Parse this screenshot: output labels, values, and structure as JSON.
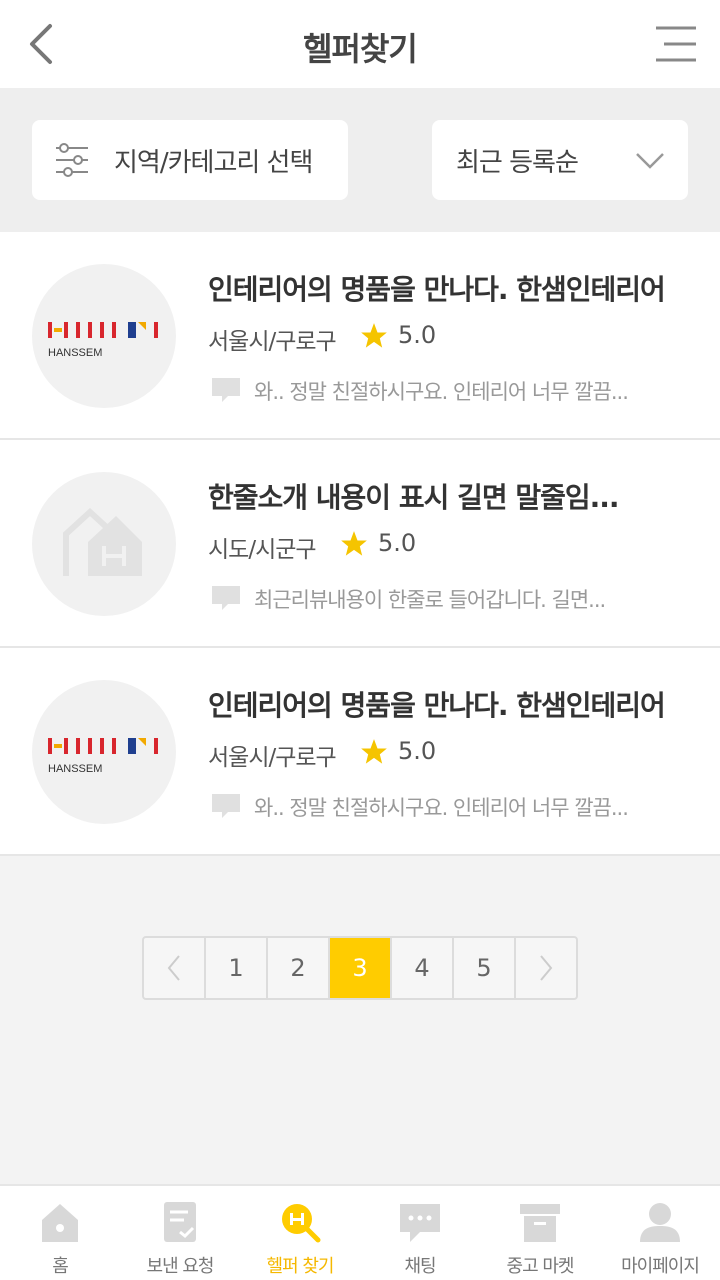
{
  "header": {
    "title": "헬퍼찾기"
  },
  "filters": {
    "region_label": "지역/카테고리 선택",
    "sort_label": "최근 등록순"
  },
  "helpers": [
    {
      "name": "인테리어의 명품을 만나다. 한샘인테리어",
      "region": "서울시/구로구",
      "rating": "5.0",
      "review": "와.. 정말 친절하시구요. 인테리어 너무 깔끔...",
      "logo": "hanssem",
      "logo_text": "HANSSEM"
    },
    {
      "name": "한줄소개 내용이 표시 길면 말줄임...",
      "region": "시도/시군구",
      "rating": "5.0",
      "review": "최근리뷰내용이 한줄로 들어갑니다. 길면...",
      "logo": "placeholder-house"
    },
    {
      "name": "인테리어의 명품을 만나다. 한샘인테리어",
      "region": "서울시/구로구",
      "rating": "5.0",
      "review": "와.. 정말 친절하시구요. 인테리어 너무 깔끔...",
      "logo": "hanssem",
      "logo_text": "HANSSEM"
    }
  ],
  "pagination": {
    "pages": [
      "1",
      "2",
      "3",
      "4",
      "5"
    ],
    "current": "3"
  },
  "tabs": [
    {
      "label": "홈",
      "icon": "home-icon"
    },
    {
      "label": "보낸 요청",
      "icon": "document-check-icon"
    },
    {
      "label": "헬퍼 찾기",
      "icon": "helper-search-icon",
      "active": true
    },
    {
      "label": "채팅",
      "icon": "chat-icon"
    },
    {
      "label": "중고 마켓",
      "icon": "box-icon"
    },
    {
      "label": "마이페이지",
      "icon": "user-icon"
    }
  ],
  "colors": {
    "accent": "#ffcc00",
    "star": "#f5c400",
    "text": "#333333",
    "muted": "#999999"
  }
}
